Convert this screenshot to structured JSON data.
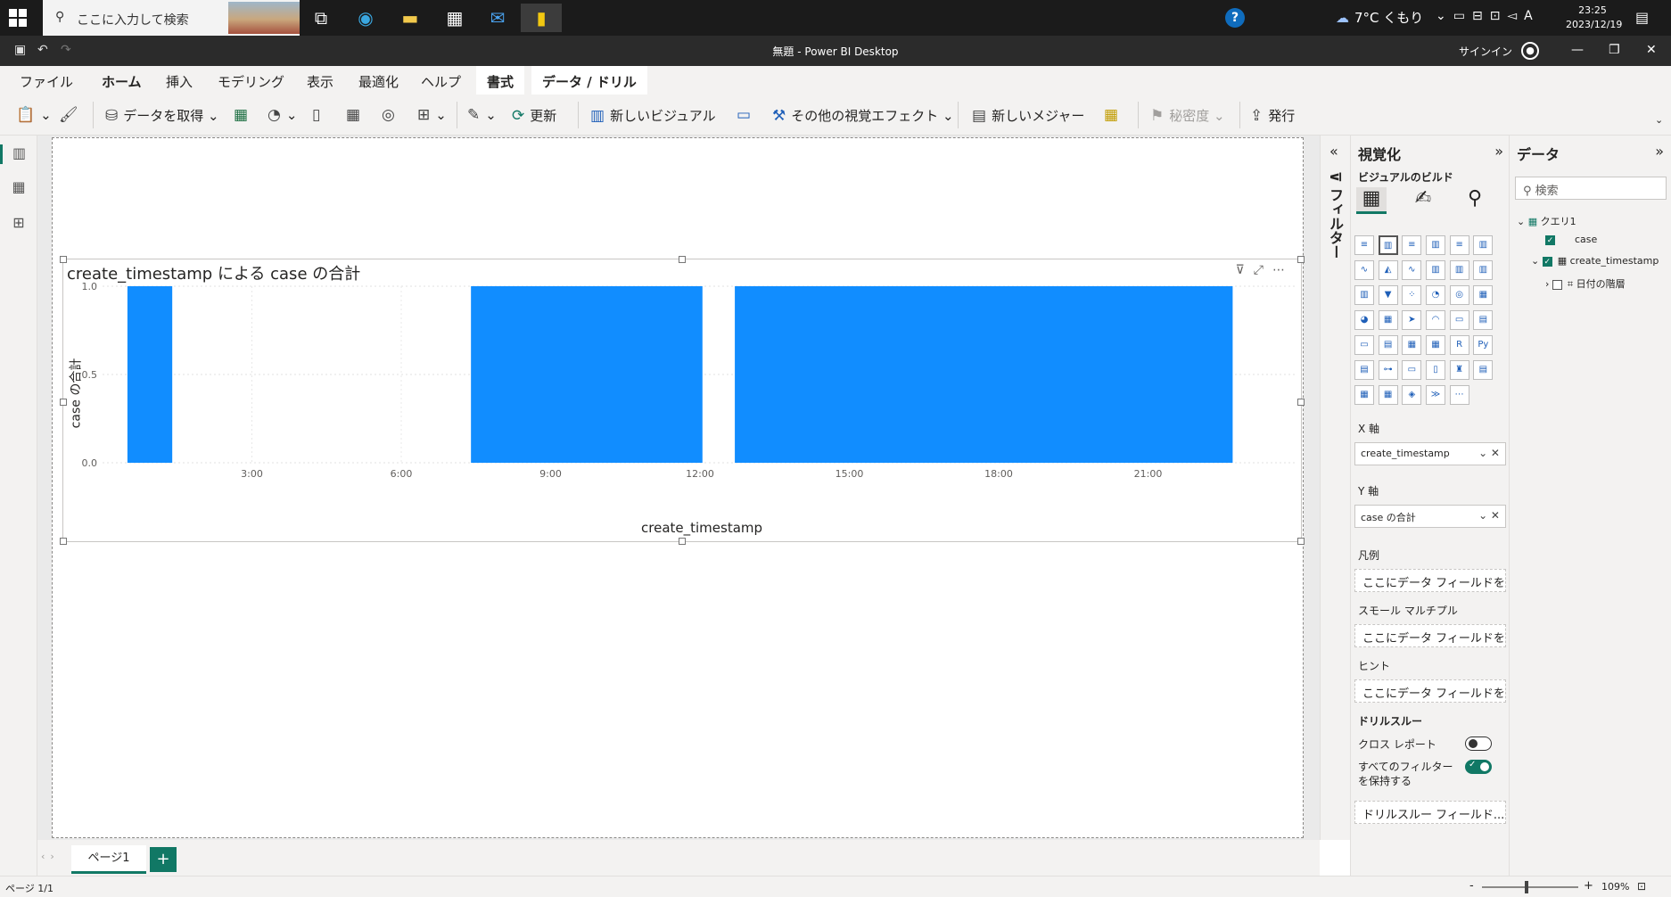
{
  "taskbar": {
    "search_placeholder": "ここに入力して検索",
    "weather": "7°C くもり",
    "time": "23:25",
    "date": "2023/12/19"
  },
  "window": {
    "title": "無題 - Power BI Desktop",
    "signin": "サインイン"
  },
  "menu": {
    "tabs": [
      "ファイル",
      "ホーム",
      "挿入",
      "モデリング",
      "表示",
      "最適化",
      "ヘルプ",
      "書式",
      "データ / ドリル"
    ],
    "active": "ホーム"
  },
  "ribbon": {
    "get_data": "データを取得",
    "refresh": "更新",
    "new_visual": "新しいビジュアル",
    "more_visuals": "その他の視覚エフェクト",
    "new_measure": "新しいメジャー",
    "sensitivity": "秘密度",
    "publish": "発行"
  },
  "visual": {
    "title": "create_timestamp による case の合計"
  },
  "chart_data": {
    "type": "bar",
    "title": "create_timestamp による case の合計",
    "xlabel": "create_timestamp",
    "ylabel": "case の合計",
    "ylim": [
      0,
      1
    ],
    "yticks": [
      "0.0",
      "0.5",
      "1.0"
    ],
    "xticks": [
      "3:00",
      "6:00",
      "9:00",
      "12:00",
      "15:00",
      "18:00",
      "21:00"
    ],
    "xrange_hours": [
      0,
      24
    ],
    "bars": [
      {
        "start_hour": 0.5,
        "end_hour": 1.4,
        "value": 1.0
      },
      {
        "start_hour": 7.4,
        "end_hour": 12.05,
        "value": 1.0
      },
      {
        "start_hour": 12.7,
        "end_hour": 22.7,
        "value": 1.0
      }
    ],
    "color": "#118DFF",
    "grid": true
  },
  "filters": {
    "label": "フィルター"
  },
  "viz_pane": {
    "title": "視覚化",
    "build_label": "ビジュアルのビルド",
    "x_axis_label": "X 軸",
    "x_axis_field": "create_timestamp",
    "y_axis_label": "Y 軸",
    "y_axis_field": "case の合計",
    "legend_label": "凡例",
    "small_multiples_label": "スモール マルチプル",
    "tooltips_label": "ヒント",
    "drop_placeholder": "ここにデータ フィールドを...",
    "drillthrough_label": "ドリルスルー",
    "cross_report_label": "クロス レポート",
    "keep_filters_label": "すべてのフィルターを保持する",
    "drillthrough_placeholder": "ドリルスルー フィールド...",
    "cross_report": false,
    "keep_filters": true
  },
  "data_pane": {
    "title": "データ",
    "search_placeholder": "検索",
    "table": "クエリ1",
    "fields": [
      "case",
      "create_timestamp"
    ],
    "date_hierarchy": "日付の階層"
  },
  "pages": {
    "tab": "ページ1",
    "status": "ページ 1/1"
  },
  "zoom": "109%"
}
